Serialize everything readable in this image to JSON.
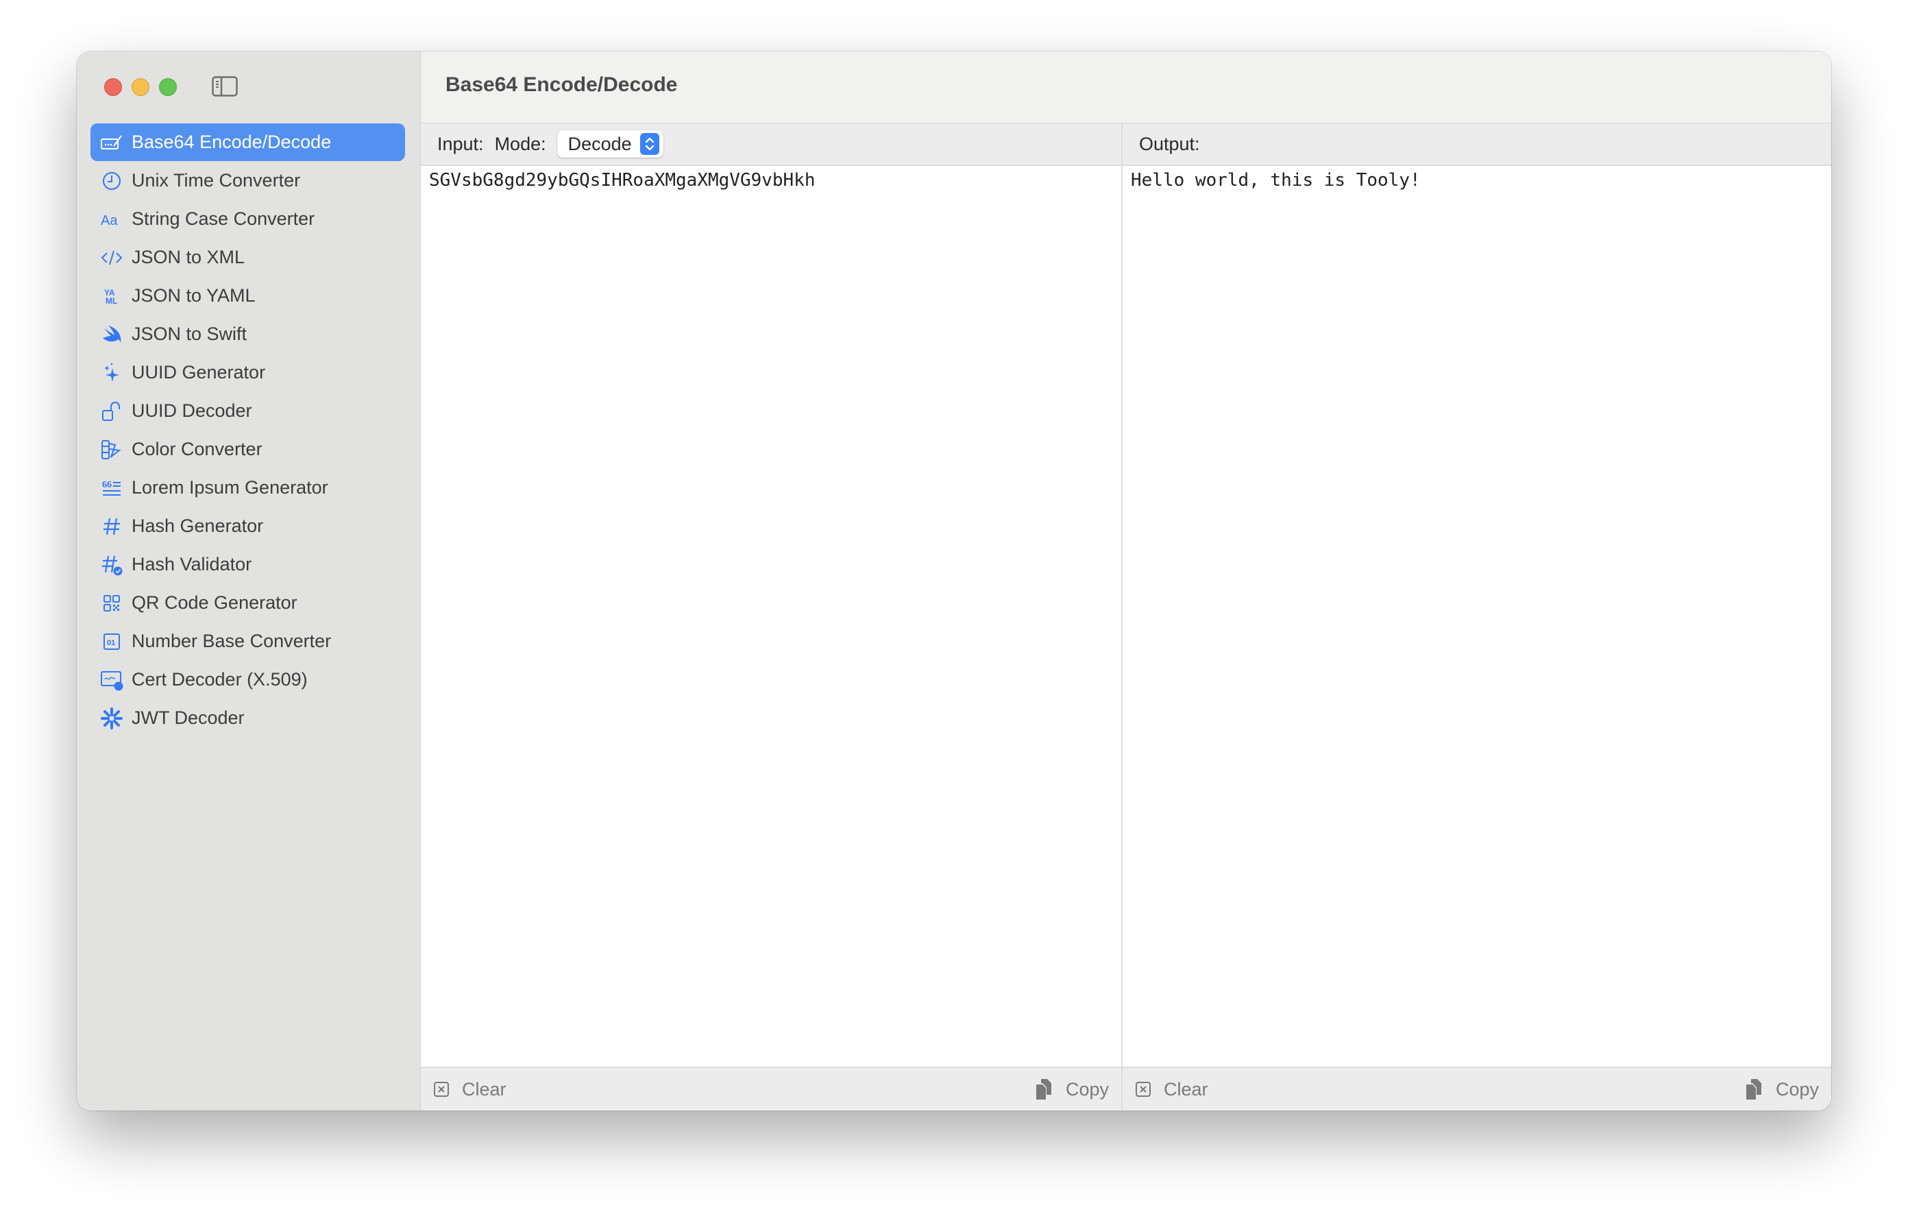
{
  "window": {
    "traffic_lights": [
      "close",
      "minimize",
      "zoom"
    ],
    "sidebar_toggle_icon": "sidebar-left-icon"
  },
  "sidebar": {
    "selected_index": 0,
    "items": [
      {
        "label": "Base64 Encode/Decode",
        "icon": "keyboard-pencil-icon"
      },
      {
        "label": "Unix Time Converter",
        "icon": "clock-icon"
      },
      {
        "label": "String Case Converter",
        "icon": "textformat-icon"
      },
      {
        "label": "JSON to XML",
        "icon": "code-brackets-icon"
      },
      {
        "label": "JSON to YAML",
        "icon": "yaml-icon"
      },
      {
        "label": "JSON to Swift",
        "icon": "swift-icon"
      },
      {
        "label": "UUID Generator",
        "icon": "sparkles-icon"
      },
      {
        "label": "UUID Decoder",
        "icon": "lock-open-icon"
      },
      {
        "label": "Color Converter",
        "icon": "swatchpalette-icon"
      },
      {
        "label": "Lorem Ipsum Generator",
        "icon": "text-quote-icon"
      },
      {
        "label": "Hash Generator",
        "icon": "number-sign-icon"
      },
      {
        "label": "Hash Validator",
        "icon": "number-checkmark-icon"
      },
      {
        "label": "QR Code Generator",
        "icon": "qrcode-icon"
      },
      {
        "label": "Number Base Converter",
        "icon": "binary-icon"
      },
      {
        "label": "Cert Decoder (X.509)",
        "icon": "certificate-icon"
      },
      {
        "label": "JWT Decoder",
        "icon": "jwt-asterisk-icon"
      }
    ]
  },
  "header": {
    "title": "Base64 Encode/Decode"
  },
  "input_pane": {
    "label": "Input:",
    "mode_label": "Mode:",
    "mode_value": "Decode",
    "text": "SGVsbG8gd29ybGQsIHRoaXMgaXMgVG9vbHkh",
    "clear_label": "Clear",
    "copy_label": "Copy"
  },
  "output_pane": {
    "label": "Output:",
    "text": "Hello world, this is Tooly!",
    "clear_label": "Clear",
    "copy_label": "Copy"
  },
  "colors": {
    "accent": "#5391f0",
    "icon_blue": "#3478f6",
    "sidebar_bg": "#e2e2e1"
  }
}
